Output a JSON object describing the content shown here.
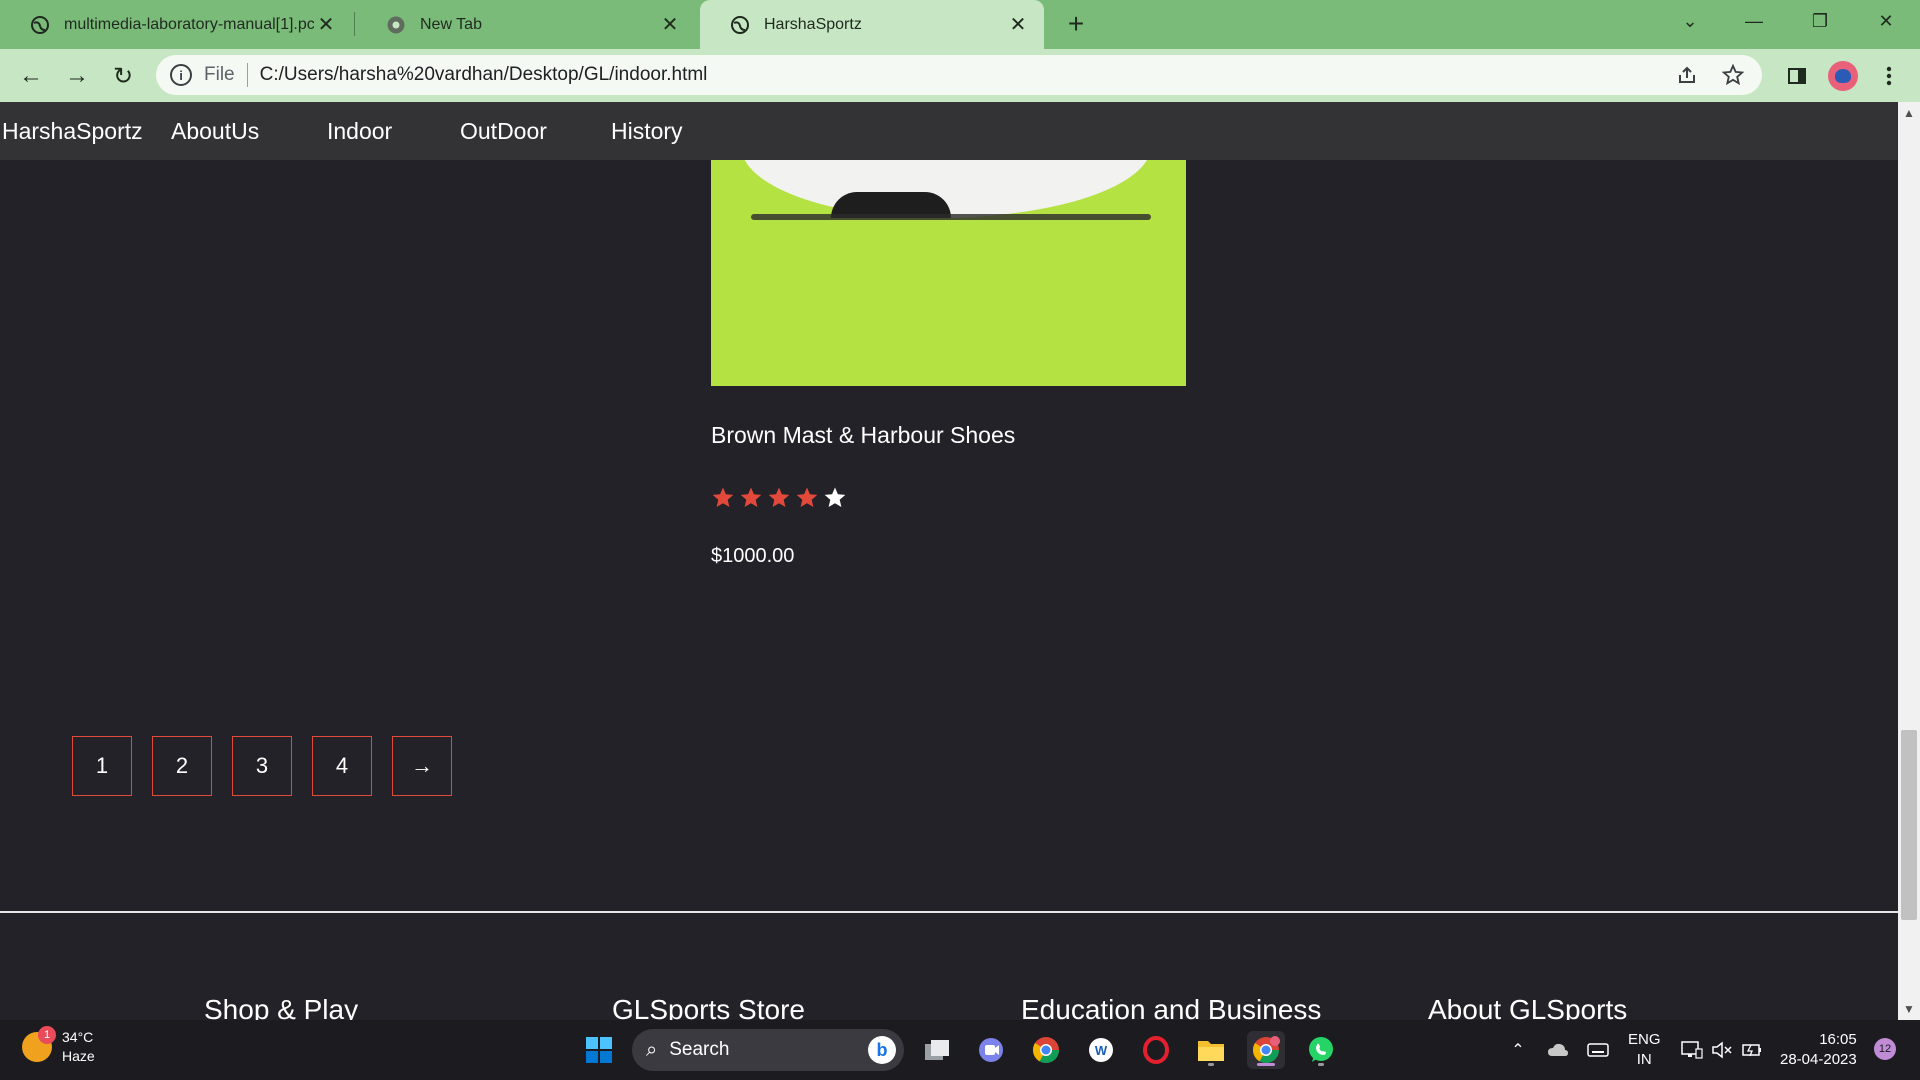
{
  "browser": {
    "tabs": [
      {
        "title": "multimedia-laboratory-manual[1].pc",
        "active": false
      },
      {
        "title": "New Tab",
        "active": false
      },
      {
        "title": "HarshaSportz",
        "active": true
      }
    ],
    "new_tab_symbol": "+",
    "close_symbol": "✕",
    "window_controls": {
      "tab_search": "⌄",
      "minimize": "—",
      "restore": "❐",
      "close": "✕"
    },
    "toolbar": {
      "back": "←",
      "forward": "→",
      "reload": "↻"
    },
    "omnibox": {
      "info_symbol": "i",
      "scheme_label": "File",
      "url": "C:/Users/harsha%20vardhan/Desktop/GL/indoor.html"
    },
    "icons": [
      "share-icon",
      "star-icon",
      "side-panel-icon",
      "profile-avatar",
      "menu-icon"
    ]
  },
  "site": {
    "nav": {
      "brand": "HarshaSportz",
      "links": [
        "AboutUs",
        "Indoor",
        "OutDoor",
        "History"
      ]
    },
    "product": {
      "name": "Brown Mast & Harbour Shoes",
      "rating": 4,
      "rating_max": 5,
      "price": "$1000.00",
      "image_bg": "#b4e243"
    },
    "pagination": [
      "1",
      "2",
      "3",
      "4",
      "→"
    ],
    "footer_headings": [
      "Shop & Play",
      "GLSports Store",
      "Education and Business",
      "About GLSports"
    ],
    "colors": {
      "background": "#232228",
      "nav": "#333336",
      "star_filled": "#e2493b",
      "star_empty": "#ffffff",
      "pager_border": "#e2493b"
    }
  },
  "taskbar": {
    "weather": {
      "temp": "34°C",
      "condition": "Haze",
      "badge": "1"
    },
    "search_label": "Search",
    "apps": [
      "start-icon",
      "search",
      "task-view-icon",
      "teams-icon",
      "chrome-icon",
      "word-icon",
      "opera-icon",
      "file-explorer-icon",
      "chrome-active-icon",
      "whatsapp-icon"
    ],
    "tray": {
      "lang_top": "ENG",
      "lang_bottom": "IN",
      "time": "16:05",
      "date": "28-04-2023",
      "notifications": "12"
    }
  }
}
